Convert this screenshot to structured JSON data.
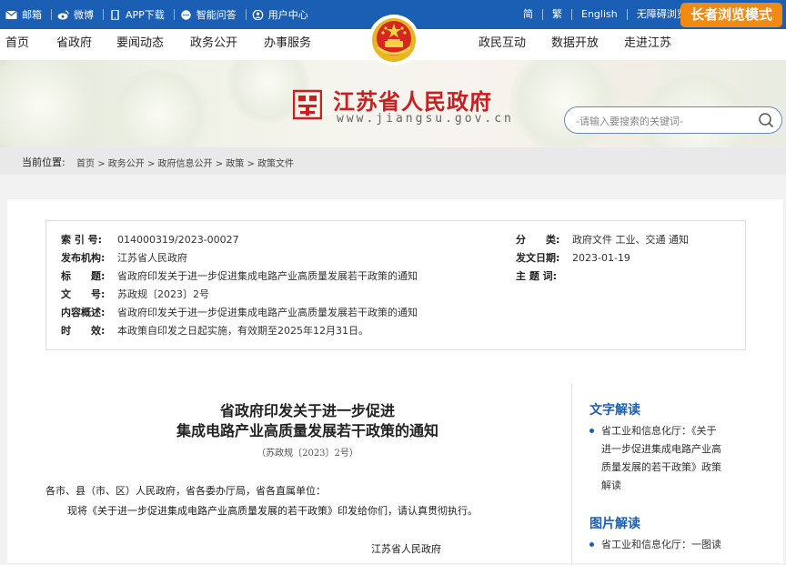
{
  "topbar": {
    "items": [
      {
        "label": "邮箱",
        "icon": "mail-icon"
      },
      {
        "label": "微博",
        "icon": "weibo-icon"
      },
      {
        "label": "APP下载",
        "icon": "phone-icon"
      },
      {
        "label": "智能问答",
        "icon": "chat-icon"
      },
      {
        "label": "用户中心",
        "icon": "user-icon"
      }
    ],
    "right_items": [
      "简",
      "繁",
      "English",
      "无障碍浏览"
    ],
    "elder_mode": "长者浏览模式",
    "color": "#1b5fb5"
  },
  "nav": {
    "left": [
      "首页",
      "省政府",
      "要闻动态",
      "政务公开",
      "办事服务"
    ],
    "right": [
      "政民互动",
      "数据开放",
      "走进江苏"
    ]
  },
  "header": {
    "site_name": "江苏省人民政府",
    "site_url": "www.jiangsu.gov.cn",
    "search_placeholder": "-请输入要搜索的关键词-"
  },
  "breadcrumb": {
    "label": "当前位置:",
    "items": [
      "首页",
      "政务公开",
      "政府信息公开",
      "政策",
      "政策文件"
    ],
    "sep": ">"
  },
  "meta": {
    "index_label": "索 引 号:",
    "index_value": "014000319/2023-00027",
    "publisher_label": "发布机构:",
    "publisher_value": "江苏省人民政府",
    "title_label": "标　　题:",
    "title_value": "省政府印发关于进一步促进集成电路产业高质量发展若干政策的通知",
    "docno_label": "文　　号:",
    "docno_value": "苏政规〔2023〕2号",
    "summary_label": "内容概述:",
    "summary_value": "省政府印发关于进一步促进集成电路产业高质量发展若干政策的通知",
    "valid_label": "时　　效:",
    "valid_value": "本政策自印发之日起实施，有效期至2025年12月31日。",
    "category_label": "分　　类:",
    "category_value": "政府文件 工业、交通 通知",
    "date_label": "发文日期:",
    "date_value": "2023-01-19",
    "keywords_label": "主 题 词:",
    "keywords_value": ""
  },
  "document": {
    "title_line1": "省政府印发关于进一步促进",
    "title_line2": "集成电路产业高质量发展若干政策的通知",
    "number": "（苏政规〔2023〕2号）",
    "addressee": "各市、县（市、区）人民政府，省各委办厅局，省各直属单位：",
    "body": "现将《关于进一步促进集成电路产业高质量发展的若干政策》印发给你们，请认真贯彻执行。",
    "signature": "江苏省人民政府"
  },
  "sidebar": {
    "text_heading": "文字解读",
    "text_item": "省工业和信息化厅：《关于进一步促进集成电路产业高质量发展的若干政策》政策解读",
    "text_lines": [
      "省工业和信息化厅：《关于",
      "进一步促进集成电路产业高",
      "质量发展的若干政策》政策",
      "解读"
    ],
    "image_heading": "图片解读",
    "image_item": "省工业和信息化厅：一图读"
  }
}
